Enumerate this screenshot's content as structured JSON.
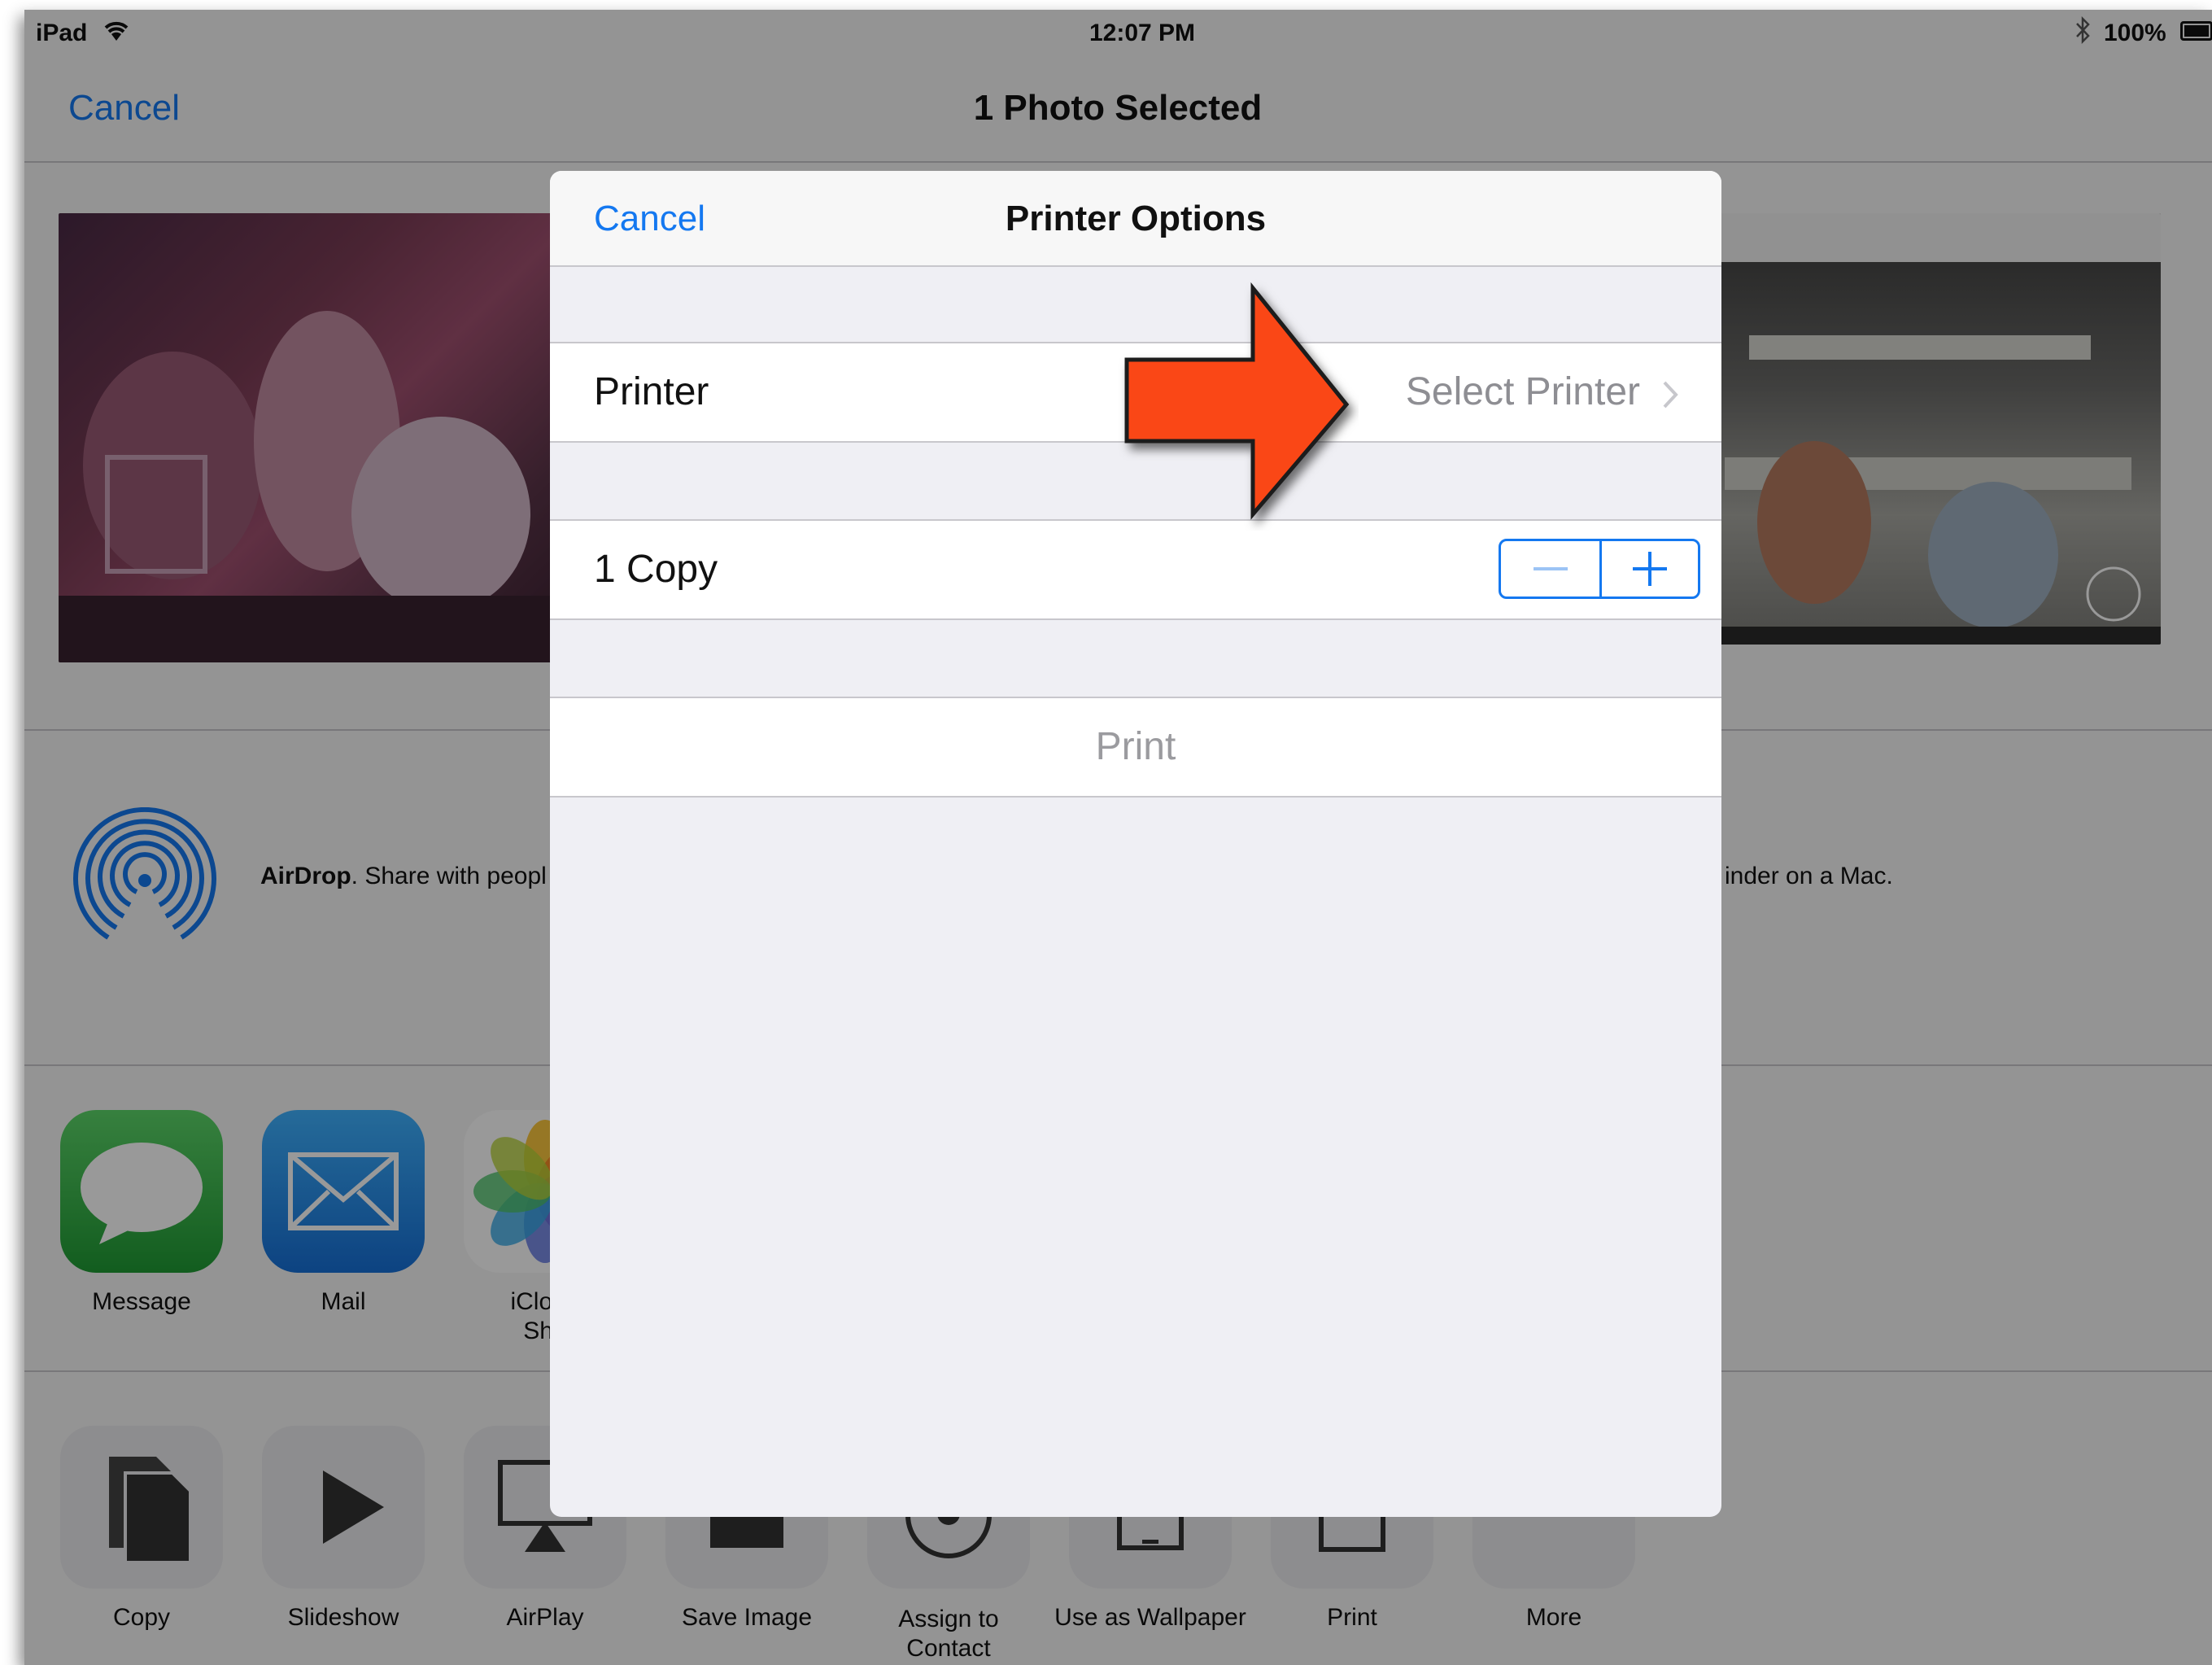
{
  "status_bar": {
    "device": "iPad",
    "time": "12:07 PM",
    "battery": "100%"
  },
  "nav": {
    "cancel": "Cancel",
    "title": "1 Photo Selected"
  },
  "airdrop": {
    "bold": "AirDrop",
    "left_text": ". Share with peopl",
    "right_text": "inder on a Mac."
  },
  "apps": [
    {
      "label": "Message",
      "icon": "message-icon",
      "color": "#34c14a"
    },
    {
      "label": "Mail",
      "icon": "mail-icon",
      "color": "#1f8ef0"
    },
    {
      "label": "iCloud",
      "label2": "Sha",
      "icon": "photos-icon"
    }
  ],
  "actions": [
    {
      "label": "Copy",
      "icon": "copy-icon"
    },
    {
      "label": "Slideshow",
      "icon": "play-icon"
    },
    {
      "label": "AirPlay",
      "icon": "airplay-icon"
    },
    {
      "label": "Save Image",
      "icon": "save-image-icon"
    },
    {
      "label": "Assign to",
      "label2": "Contact",
      "icon": "contact-icon"
    },
    {
      "label": "Use as Wallpaper",
      "icon": "wallpaper-icon"
    },
    {
      "label": "Print",
      "icon": "print-icon"
    },
    {
      "label": "More",
      "icon": "more-icon"
    }
  ],
  "sheet": {
    "cancel": "Cancel",
    "title": "Printer Options",
    "printer_label": "Printer",
    "printer_value": "Select Printer",
    "copies_label": "1 Copy",
    "print_button": "Print"
  },
  "colors": {
    "accent": "#1478f0",
    "arrow": "#fa4616"
  }
}
